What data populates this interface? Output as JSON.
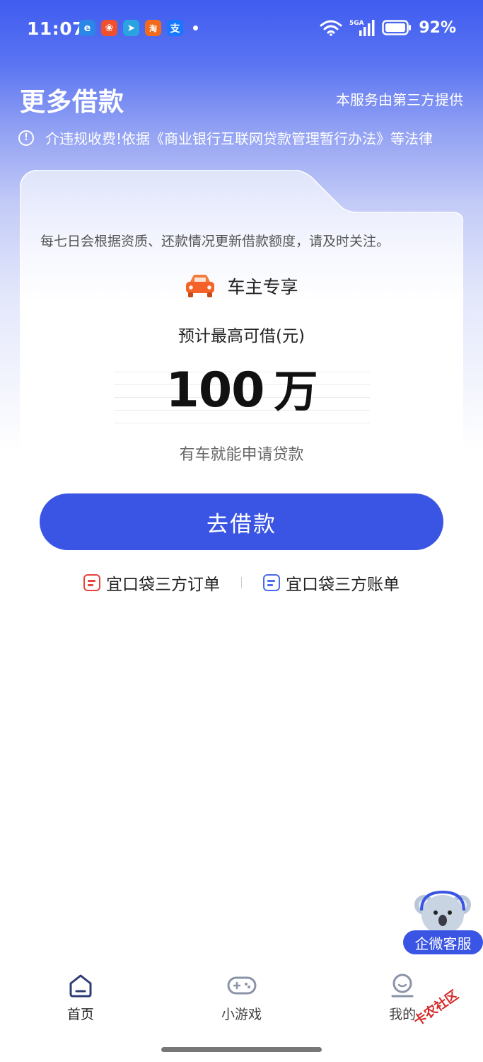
{
  "status_bar": {
    "time": "11:07",
    "app_icons": [
      {
        "name": "browser-app-icon",
        "glyph": "e",
        "color": "#2a87e8"
      },
      {
        "name": "app-red-icon",
        "glyph": "❀",
        "color": "#f0502e"
      },
      {
        "name": "telegram-app-icon",
        "glyph": "➤",
        "color": "#2aa3e0"
      },
      {
        "name": "taobao-app-icon",
        "glyph": "淘",
        "color": "#f26a1b"
      },
      {
        "name": "alipay-app-icon",
        "glyph": "支",
        "color": "#1677ff"
      }
    ],
    "battery": "92%"
  },
  "header": {
    "title": "更多借款",
    "third_party_note": "本服务由第三方提供",
    "notice": "介违规收费!依据《商业银行互联网贷款管理暂行办法》等法律"
  },
  "card": {
    "description": "每七日会根据资质、还款情况更新借款额度，请及时关注。",
    "owner_label": "车主专享",
    "estimate_label": "预计最高可借(元)",
    "amount_value": "100",
    "amount_unit": "万",
    "hint": "有车就能申请贷款",
    "cta_label": "去借款",
    "links": [
      {
        "label": "宜口袋三方订单",
        "icon": "order-doc-icon"
      },
      {
        "label": "宜口袋三方账单",
        "icon": "bill-doc-icon"
      }
    ]
  },
  "customer_service": {
    "label": "企微客服"
  },
  "bottom_nav": {
    "items": [
      {
        "label": "首页",
        "icon": "home-icon",
        "active": true
      },
      {
        "label": "小游戏",
        "icon": "gamepad-icon",
        "active": false
      },
      {
        "label": "我的",
        "icon": "profile-icon",
        "active": false
      }
    ]
  },
  "watermark": "卡农社区",
  "colors": {
    "accent": "#3a55e3",
    "header_gradient_top": "#3f5cf0",
    "order_icon": "#e8423e",
    "bill_icon": "#4a6cf0"
  }
}
